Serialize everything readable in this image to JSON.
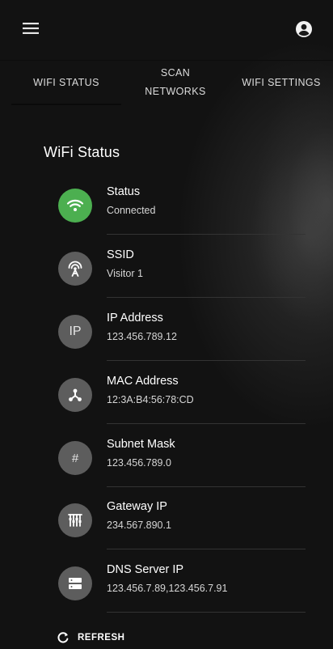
{
  "tabs": [
    {
      "label": "WIFI STATUS"
    },
    {
      "label": "SCAN\nNETWORKS"
    },
    {
      "label": "WIFI SETTINGS"
    }
  ],
  "section": {
    "title": "WiFi Status"
  },
  "items": [
    {
      "label": "Status",
      "value": "Connected",
      "icon": "wifi-icon"
    },
    {
      "label": "SSID",
      "value": "Visitor 1",
      "icon": "antenna-icon"
    },
    {
      "label": "IP Address",
      "value": "123.456.789.12",
      "icon_text": "IP"
    },
    {
      "label": "MAC Address",
      "value": "12:3A:B4:56:78:CD",
      "icon": "network-icon"
    },
    {
      "label": "Subnet Mask",
      "value": "123.456.789.0",
      "icon_text": "#"
    },
    {
      "label": "Gateway IP",
      "value": "234.567.890.1",
      "icon": "router-icon"
    },
    {
      "label": "DNS Server IP",
      "value": "123.456.7.89,123.456.7.91",
      "icon": "server-icon"
    }
  ],
  "refresh": {
    "label": "REFRESH"
  },
  "colors": {
    "status_connected": "#4caf50",
    "icon_bg": "#5d5d5d"
  }
}
